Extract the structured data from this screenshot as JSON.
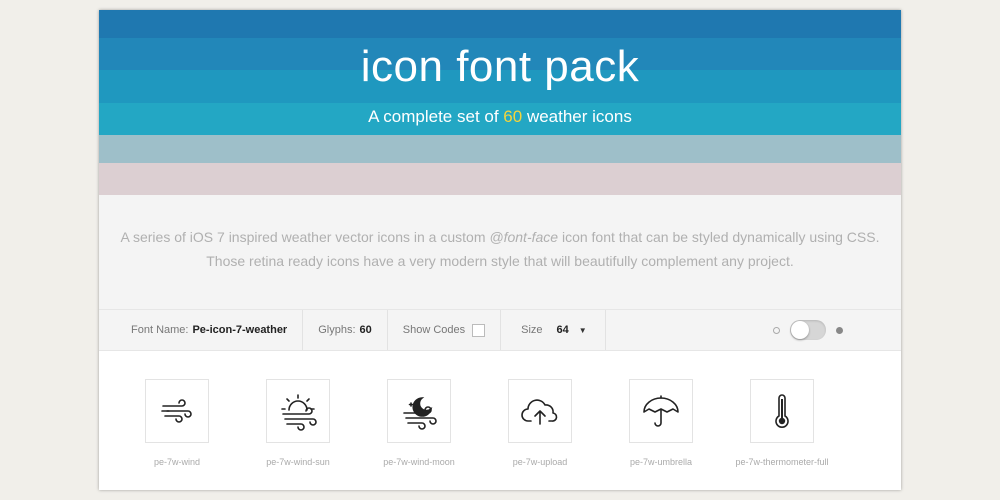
{
  "hero": {
    "title": "icon font pack",
    "subtitle_before": "A complete set of ",
    "subtitle_number": "60",
    "subtitle_after": " weather icons"
  },
  "intro": {
    "line1_before": "A series of iOS 7 inspired weather vector icons in a custom ",
    "line1_em": "@font-face",
    "line1_after": " icon font that can be styled dynamically using CSS.",
    "line2": "Those retina ready icons have a very modern style that will beautifully complement any project."
  },
  "toolbar": {
    "font_name_label": "Font Name:",
    "font_name_value": "Pe-icon-7-weather",
    "glyphs_label": "Glyphs:",
    "glyphs_value": "60",
    "show_codes_label": "Show Codes",
    "size_label": "Size",
    "size_value": "64"
  },
  "icons": [
    {
      "label": "pe-7w-wind",
      "icon": "wind-icon"
    },
    {
      "label": "pe-7w-wind-sun",
      "icon": "wind-sun-icon"
    },
    {
      "label": "pe-7w-wind-moon",
      "icon": "wind-moon-icon"
    },
    {
      "label": "pe-7w-upload",
      "icon": "upload-cloud-icon"
    },
    {
      "label": "pe-7w-umbrella",
      "icon": "umbrella-icon"
    },
    {
      "label": "pe-7w-thermometer-full",
      "icon": "thermometer-full-icon"
    }
  ],
  "colors": {
    "stripe_1": "#1f78b0",
    "stripe_2": "#2287b9",
    "stripe_3": "#1f98bf",
    "stripe_4": "#23a7c4",
    "stripe_5": "#9ebfc9",
    "stripe_6": "#dccfd2",
    "accent_number": "#f3d43c"
  }
}
